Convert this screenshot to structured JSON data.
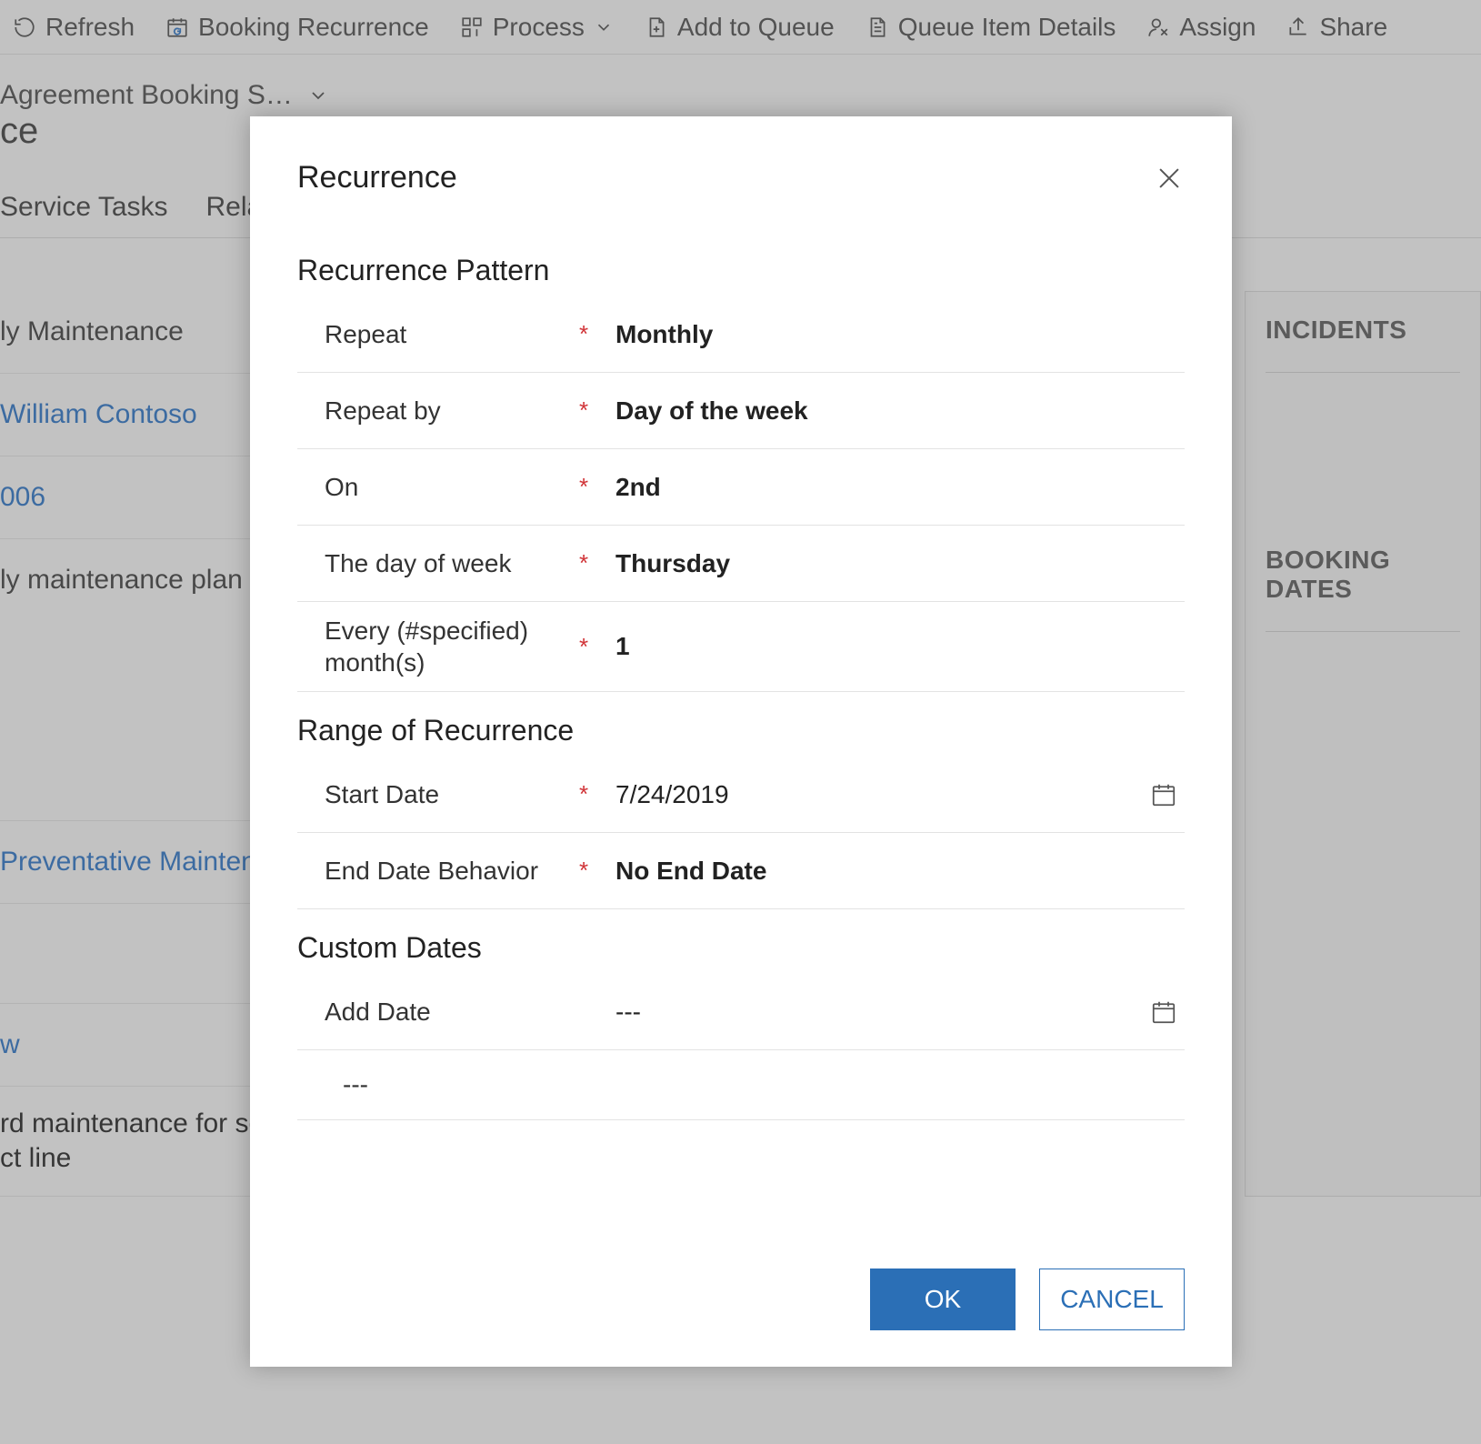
{
  "toolbar": {
    "refresh": "Refresh",
    "booking_recurrence": "Booking Recurrence",
    "process": "Process",
    "add_to_queue": "Add to Queue",
    "queue_item_details": "Queue Item Details",
    "assign": "Assign",
    "share": "Share"
  },
  "page": {
    "breadcrumb": "Agreement Booking S…",
    "title_partial": "ce",
    "tabs": {
      "service_tasks": "Service Tasks",
      "related": "Related"
    }
  },
  "bg_fields": {
    "maintenance_name": "ly Maintenance",
    "owner": "William Contoso",
    "code": "006",
    "plan": "ly maintenance plan f",
    "preventative": "Preventative Maintenance",
    "w": "w",
    "std1": "rd maintenance for se",
    "std2": "ct line"
  },
  "side": {
    "incidents": "INCIDENTS",
    "booking_dates": "BOOKING DATES"
  },
  "dialog": {
    "title": "Recurrence",
    "sections": {
      "pattern": "Recurrence Pattern",
      "range": "Range of Recurrence",
      "custom": "Custom Dates"
    },
    "labels": {
      "repeat": "Repeat",
      "repeat_by": "Repeat by",
      "on": "On",
      "day_of_week": "The day of week",
      "every_months": "Every (#specified) month(s)",
      "start_date": "Start Date",
      "end_behavior": "End Date Behavior",
      "add_date": "Add Date"
    },
    "values": {
      "repeat": "Monthly",
      "repeat_by": "Day of the week",
      "on": "2nd",
      "day_of_week": "Thursday",
      "every_months": "1",
      "start_date": "7/24/2019",
      "end_behavior": "No End Date",
      "add_date": "---",
      "custom_row": "---"
    },
    "buttons": {
      "ok": "OK",
      "cancel": "CANCEL"
    }
  }
}
